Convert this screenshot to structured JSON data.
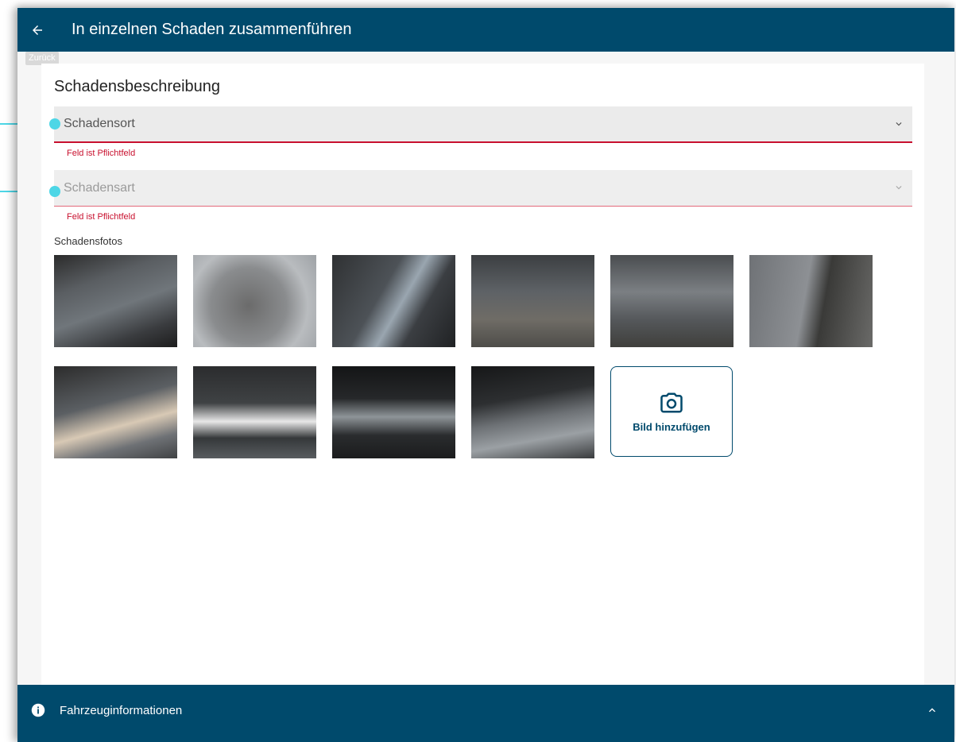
{
  "header": {
    "title": "In einzelnen Schaden zusammenführen",
    "back_tooltip": "Zurück"
  },
  "form": {
    "section_title": "Schadensbeschreibung",
    "fields": [
      {
        "label": "Schadensort",
        "error": "Feld ist Pflichtfeld"
      },
      {
        "label": "Schadensart",
        "error": "Feld ist Pflichtfeld"
      }
    ],
    "photos_label": "Schadensfotos",
    "add_photo_label": "Bild hinzufügen"
  },
  "footer": {
    "title": "Fahrzeuginformationen"
  },
  "colors": {
    "primary": "#004a6c",
    "error": "#c8102e",
    "annotation": "#4dd6e6"
  }
}
